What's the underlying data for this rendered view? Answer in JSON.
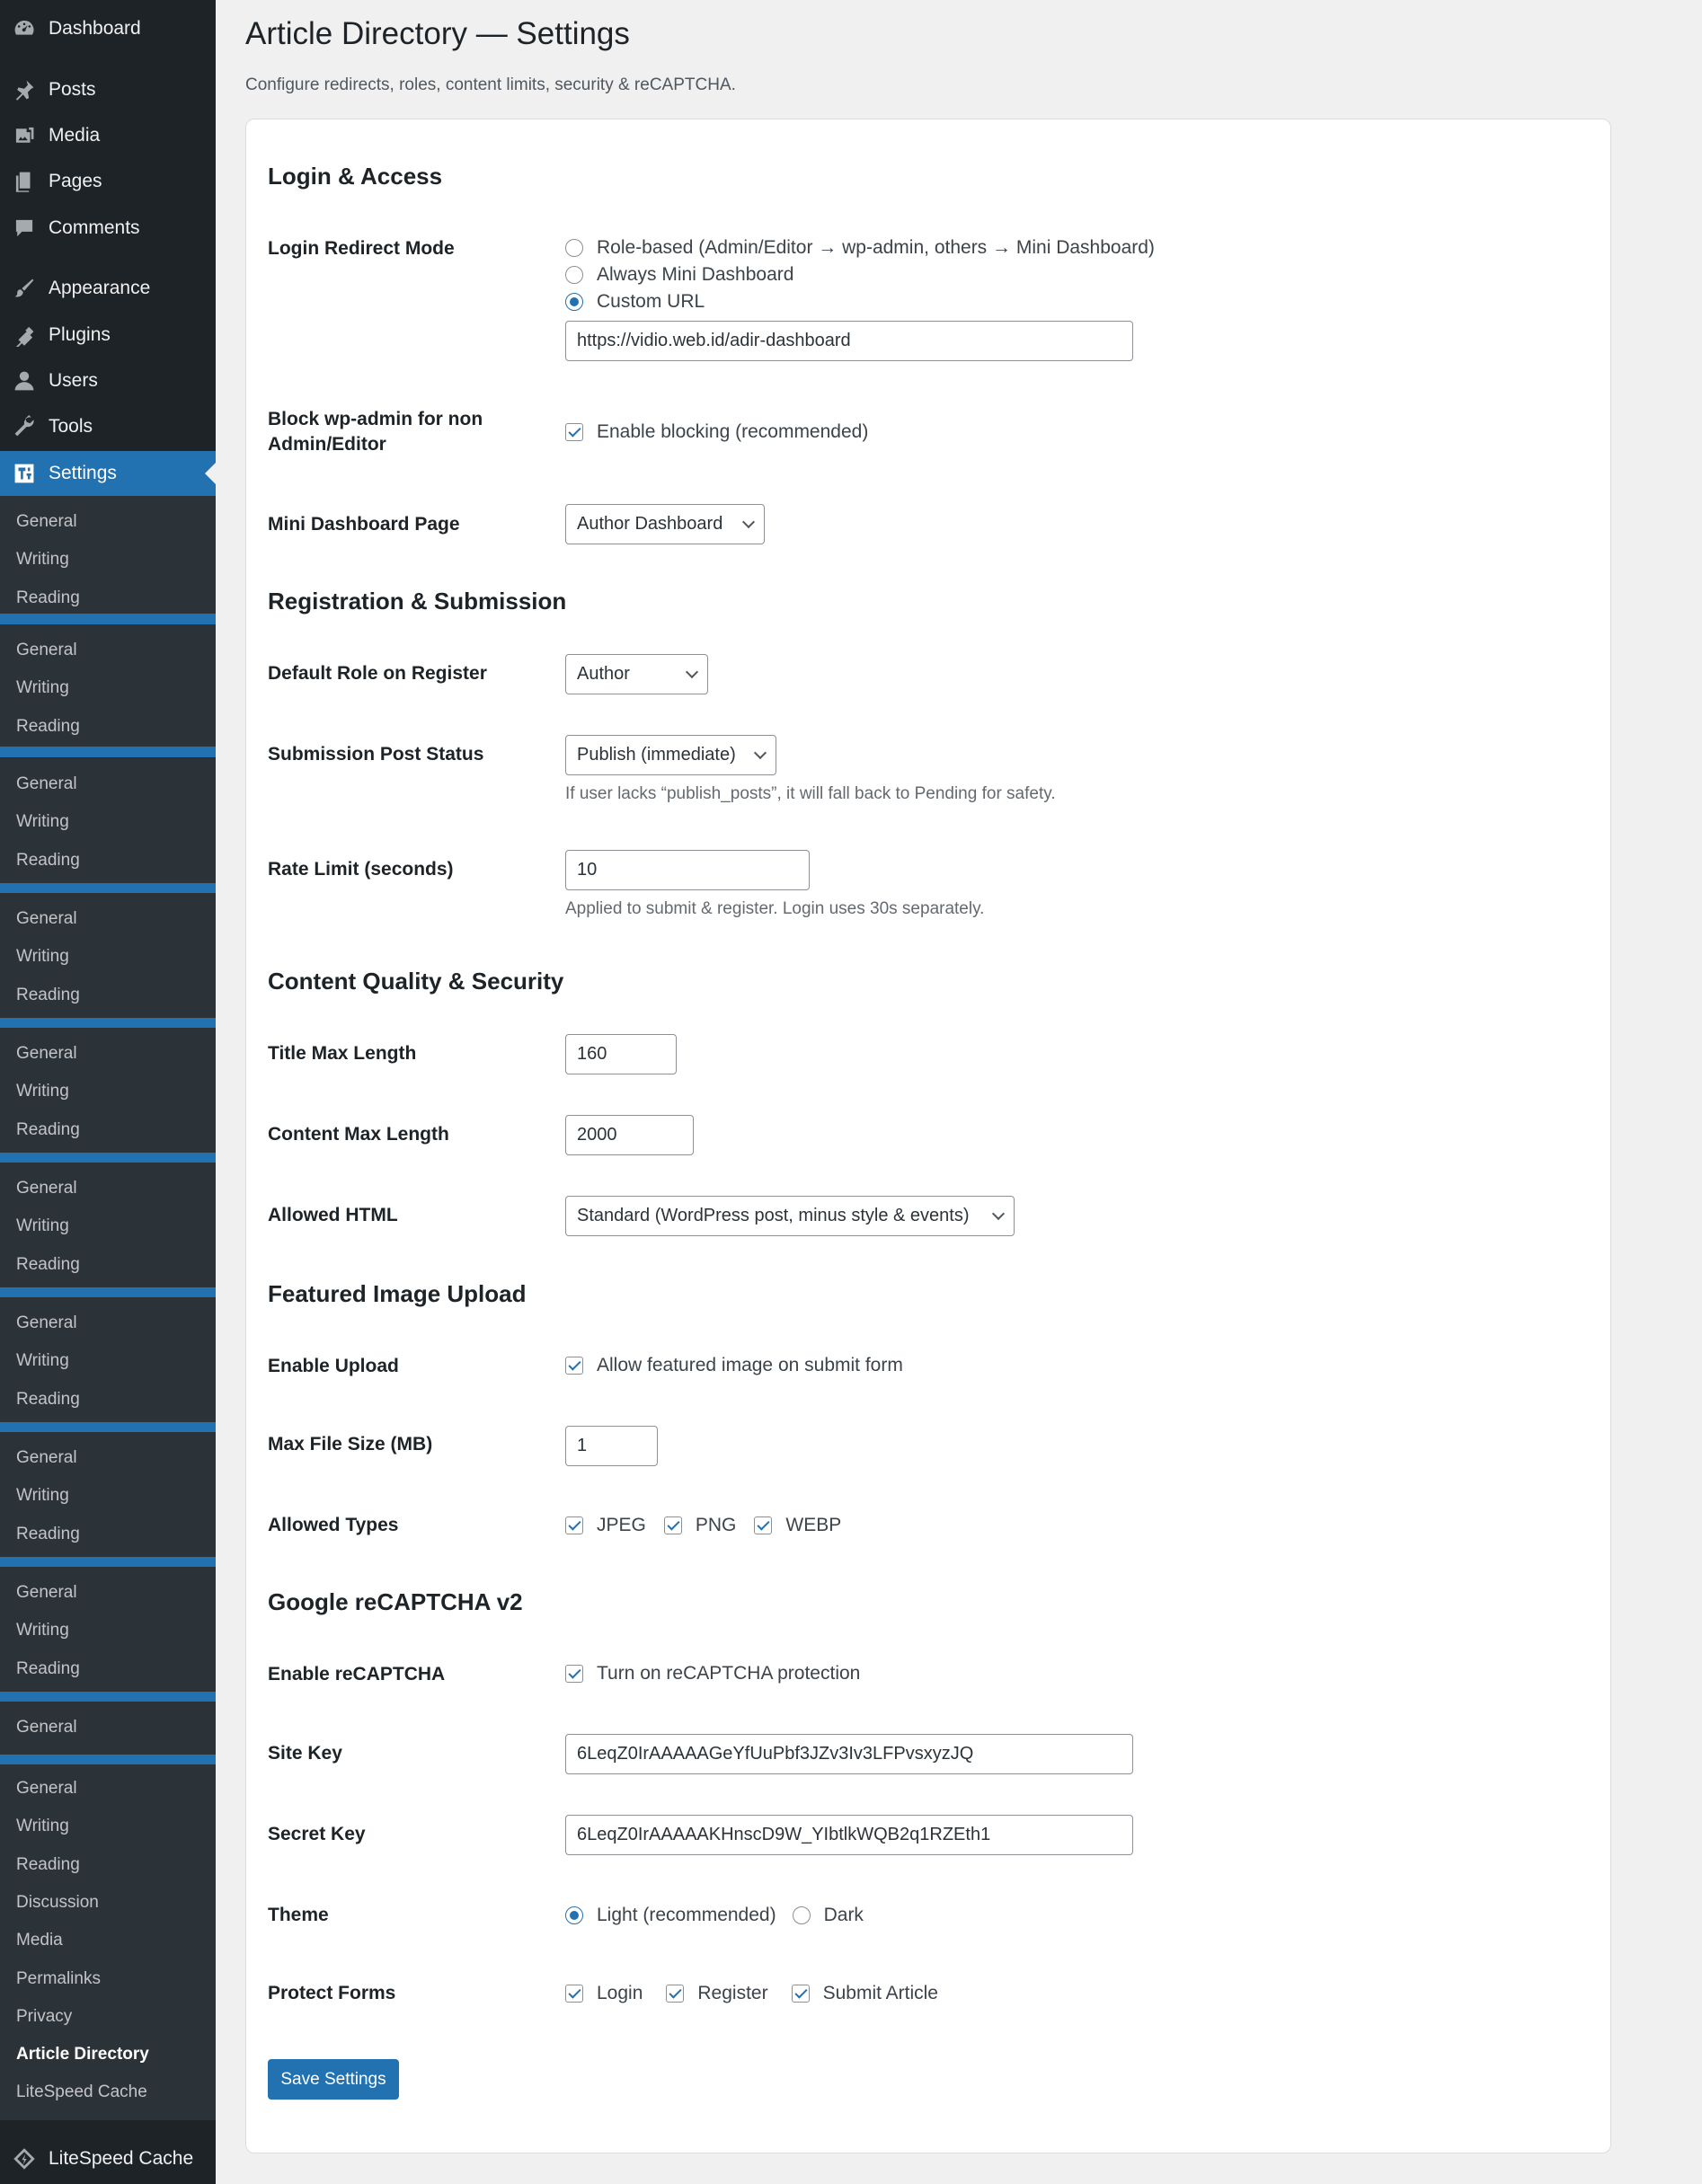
{
  "sidebar": {
    "menu": [
      {
        "label": "Dashboard",
        "icon": "dashboard-icon"
      },
      {
        "label": "Posts",
        "icon": "pin-icon"
      },
      {
        "label": "Media",
        "icon": "media-icon"
      },
      {
        "label": "Pages",
        "icon": "pages-icon"
      },
      {
        "label": "Comments",
        "icon": "comment-icon"
      },
      {
        "label": "Appearance",
        "icon": "brush-icon"
      },
      {
        "label": "Plugins",
        "icon": "plugin-icon"
      },
      {
        "label": "Users",
        "icon": "user-icon"
      },
      {
        "label": "Tools",
        "icon": "wrench-icon"
      },
      {
        "label": "Settings",
        "icon": "settings-icon"
      }
    ],
    "submenu_triplet": [
      "General",
      "Writing",
      "Reading"
    ],
    "submenu_single": "General",
    "submenu_final": [
      "General",
      "Writing",
      "Reading",
      "Discussion",
      "Media",
      "Permalinks",
      "Privacy",
      "Article Directory",
      "LiteSpeed Cache"
    ],
    "bottom_item": {
      "label": "LiteSpeed Cache",
      "icon": "litespeed-icon"
    },
    "colors": {
      "background": "#1d2327",
      "submenu": "#2c3338",
      "active": "#2271b1"
    }
  },
  "header": {
    "title": "Article Directory — Settings",
    "subtitle": "Configure redirects, roles, content limits, security & reCAPTCHA."
  },
  "sections": {
    "login": {
      "title": "Login & Access",
      "redirect_label": "Login Redirect Mode",
      "redirect_options": [
        "Role-based (Admin/Editor → wp-admin, others → Mini Dashboard)",
        "Always Mini Dashboard",
        "Custom URL"
      ],
      "redirect_selected": "Custom URL",
      "custom_url": "https://vidio.web.id/adir-dashboard",
      "block_label": "Block wp-admin for non Admin/Editor",
      "block_option": "Enable blocking (recommended)",
      "mini_label": "Mini Dashboard Page",
      "mini_value": "Author Dashboard"
    },
    "registration": {
      "title": "Registration & Submission",
      "role_label": "Default Role on Register",
      "role_value": "Author",
      "status_label": "Submission Post Status",
      "status_value": "Publish (immediate)",
      "status_help": "If user lacks “publish_posts”, it will fall back to Pending for safety.",
      "rate_label": "Rate Limit (seconds)",
      "rate_value": "10",
      "rate_help": "Applied to submit & register. Login uses 30s separately."
    },
    "content": {
      "title": "Content Quality & Security",
      "title_max_label": "Title Max Length",
      "title_max_value": "160",
      "content_max_label": "Content Max Length",
      "content_max_value": "2000",
      "html_label": "Allowed HTML",
      "html_value": "Standard (WordPress post, minus style & events)"
    },
    "featured": {
      "title": "Featured Image Upload",
      "enable_label": "Enable Upload",
      "enable_option": "Allow featured image on submit form",
      "size_label": "Max File Size (MB)",
      "size_value": "1",
      "types_label": "Allowed Types",
      "types": [
        "JPEG",
        "PNG",
        "WEBP"
      ]
    },
    "recaptcha": {
      "title": "Google reCAPTCHA v2",
      "enable_label": "Enable reCAPTCHA",
      "enable_option": "Turn on reCAPTCHA protection",
      "site_key_label": "Site Key",
      "site_key_value": "6LeqZ0IrAAAAAGeYfUuPbf3JZv3Iv3LFPvsxyzJQ",
      "secret_key_label": "Secret Key",
      "secret_key_value": "6LeqZ0IrAAAAAKHnscD9W_YIbtlkWQB2q1RZEth1",
      "theme_label": "Theme",
      "theme_options": [
        "Light (recommended)",
        "Dark"
      ],
      "theme_selected": "Light (recommended)",
      "protect_label": "Protect Forms",
      "protect_options": [
        "Login",
        "Register",
        "Submit Article"
      ]
    }
  },
  "actions": {
    "save_label": "Save Settings"
  },
  "colors": {
    "accent": "#2271b1",
    "page_bg": "#f0f0f1"
  }
}
